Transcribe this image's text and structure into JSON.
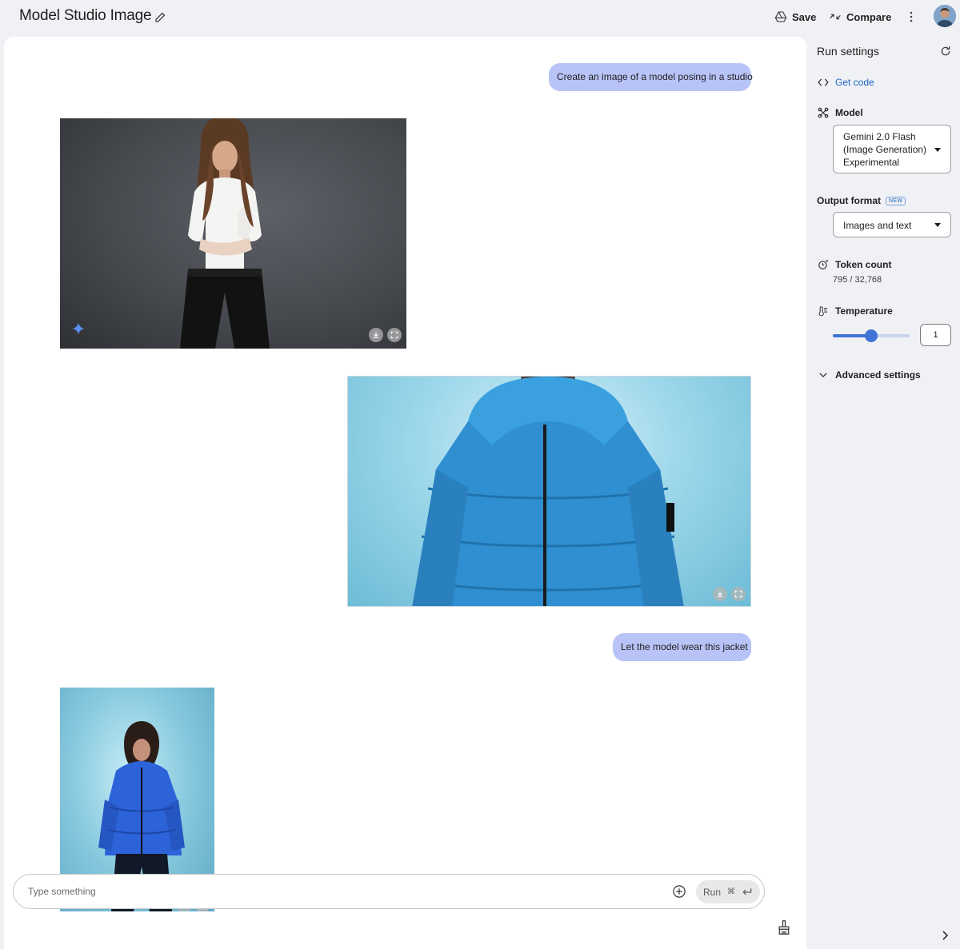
{
  "header": {
    "title": "Model Studio Image",
    "save_label": "Save",
    "compare_label": "Compare"
  },
  "chat": {
    "messages": [
      {
        "role": "user",
        "text": "Create an image of a model posing in a studio"
      },
      {
        "role": "model",
        "kind": "image",
        "subject": "woman in white shirt and black trousers, dark grey studio backdrop"
      },
      {
        "role": "user",
        "kind": "image",
        "subject": "blue puffer jacket on light blue background"
      },
      {
        "role": "user",
        "text": "Let the model wear this jacket"
      },
      {
        "role": "model",
        "kind": "image",
        "subject": "woman wearing the blue puffer jacket, light blue backdrop"
      }
    ],
    "input_placeholder": "Type something",
    "run_label": "Run",
    "run_shortcut": "⌘"
  },
  "settings": {
    "title": "Run settings",
    "get_code_label": "Get code",
    "model_label": "Model",
    "model_value_lines": [
      "Gemini 2.0 Flash",
      "(Image Generation)",
      "Experimental"
    ],
    "output_format_label": "Output format",
    "new_badge": "NEW",
    "output_format_value": "Images and text",
    "token_count_label": "Token count",
    "token_count_value": "795 / 32,768",
    "temperature_label": "Temperature",
    "temperature_value": "1",
    "temperature_fraction": 0.5,
    "advanced_label": "Advanced settings"
  },
  "colors": {
    "accent": "#3f74d6",
    "user_bubble": "#b8c3f7",
    "link": "#1a63c7"
  },
  "icons": [
    "pencil-icon",
    "drive-save-icon",
    "compare-icon",
    "more-vert-icon",
    "refresh-icon",
    "code-icon",
    "model-icon",
    "token-icon",
    "thermometer-icon",
    "chevron-down-icon",
    "download-icon",
    "fullscreen-icon",
    "sparkle-icon",
    "add-circle-icon",
    "enter-icon",
    "broom-icon",
    "chevron-right-icon"
  ]
}
